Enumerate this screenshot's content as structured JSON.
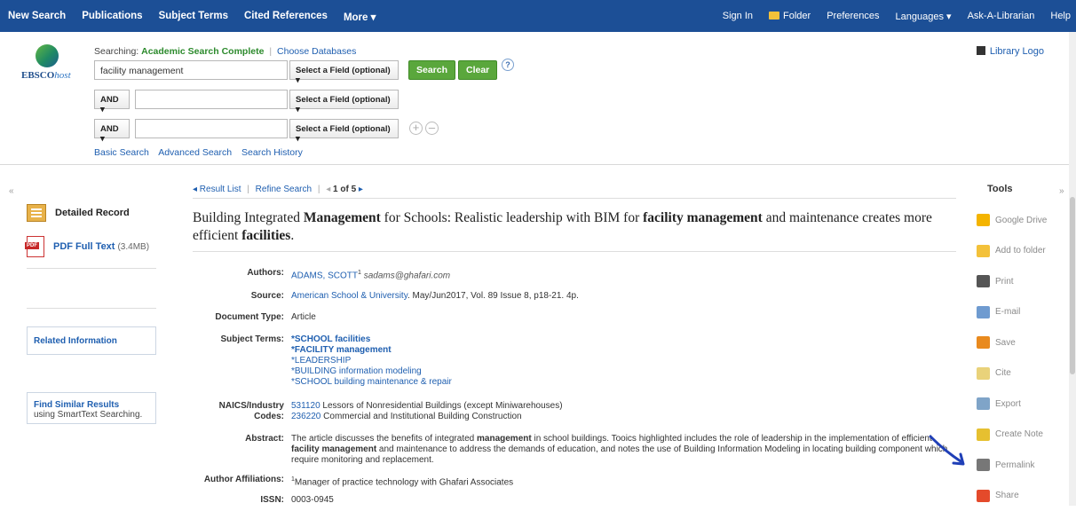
{
  "topbar": {
    "left_items": [
      "New Search",
      "Publications",
      "Subject Terms",
      "Cited References",
      "More ▾"
    ],
    "right_items": [
      "Sign In",
      "Folder",
      "Preferences",
      "Languages ▾",
      "Ask-A-Librarian",
      "Help"
    ]
  },
  "header": {
    "logo_main": "EBSCO",
    "logo_suffix": "host",
    "searching_label": "Searching:",
    "database": "Academic Search Complete",
    "choose_db": "Choose Databases",
    "row1_value": "facility management",
    "field_select": "Select a Field (optional) ▾",
    "bool": "AND ▾",
    "search_btn": "Search",
    "clear_btn": "Clear",
    "help": "?",
    "add": "+",
    "remove": "–",
    "links": [
      "Basic Search",
      "Advanced Search",
      "Search History"
    ],
    "library_logo": "Library Logo"
  },
  "left": {
    "detailed_record": "Detailed Record",
    "pdf_label": "PDF Full Text",
    "pdf_size": "(3.4MB)",
    "related": "Related Information",
    "similar_title": "Find Similar Results",
    "similar_sub": "using SmartText Searching."
  },
  "nav": {
    "result_list": "◂ Result List",
    "refine": "Refine Search",
    "prev": "◂",
    "position": "1 of 5",
    "next": "▸"
  },
  "record": {
    "title_parts": [
      "Building Integrated ",
      "Management",
      " for Schools: Realistic leadership with BIM for ",
      "facility management",
      " and maintenance creates more efficient ",
      "facilities",
      "."
    ],
    "authors_label": "Authors:",
    "author": "ADAMS, SCOTT",
    "author_sup": "1",
    "author_email": "sadams@ghafari.com",
    "source_label": "Source:",
    "source_link": "American School & University",
    "source_rest": ". May/Jun2017, Vol. 89 Issue 8, p18-21. 4p.",
    "doctype_label": "Document Type:",
    "doctype": "Article",
    "subjects_label": "Subject Terms:",
    "subjects": [
      "*SCHOOL facilities",
      "*FACILITY management",
      "*LEADERSHIP",
      "*BUILDING information modeling",
      "*SCHOOL building maintenance & repair"
    ],
    "naics_label": "NAICS/Industry Codes:",
    "naics": [
      {
        "code": "531120",
        "desc": "Lessors of Nonresidential Buildings (except Miniwarehouses)"
      },
      {
        "code": "236220",
        "desc": "Commercial and Institutional Building Construction"
      }
    ],
    "abstract_label": "Abstract:",
    "abstract_parts": [
      "The article discusses the benefits of integrated ",
      "management",
      " in school buildings. Tooics highlighted includes the role of leadership in the implementation of efficient ",
      "facility management",
      " and maintenance to address the demands of education, and notes the use of Building Information Modeling in locating building component which require monitoring and replacement."
    ],
    "affil_label": "Author Affiliations:",
    "affil_sup": "1",
    "affil": "Manager of practice technology with Ghafari Associates",
    "issn_label": "ISSN:",
    "issn": "0003-0945"
  },
  "tools": {
    "header": "Tools",
    "items": [
      {
        "label": "Google Drive",
        "icon": "google-drive-icon",
        "color": "#f4b400"
      },
      {
        "label": "Add to folder",
        "icon": "folder-icon",
        "color": "#f3c13a"
      },
      {
        "label": "Print",
        "icon": "printer-icon",
        "color": "#555555"
      },
      {
        "label": "E-mail",
        "icon": "email-icon",
        "color": "#6f9bd0"
      },
      {
        "label": "Save",
        "icon": "save-icon",
        "color": "#e98a1e"
      },
      {
        "label": "Cite",
        "icon": "cite-icon",
        "color": "#e9d27a"
      },
      {
        "label": "Export",
        "icon": "export-icon",
        "color": "#7fa4c8"
      },
      {
        "label": "Create Note",
        "icon": "note-icon",
        "color": "#e6c030"
      },
      {
        "label": "Permalink",
        "icon": "permalink-icon",
        "color": "#777777"
      },
      {
        "label": "Share",
        "icon": "share-icon",
        "color": "#e44a2b"
      }
    ]
  },
  "collapse": {
    "left": "«",
    "right": "»"
  }
}
